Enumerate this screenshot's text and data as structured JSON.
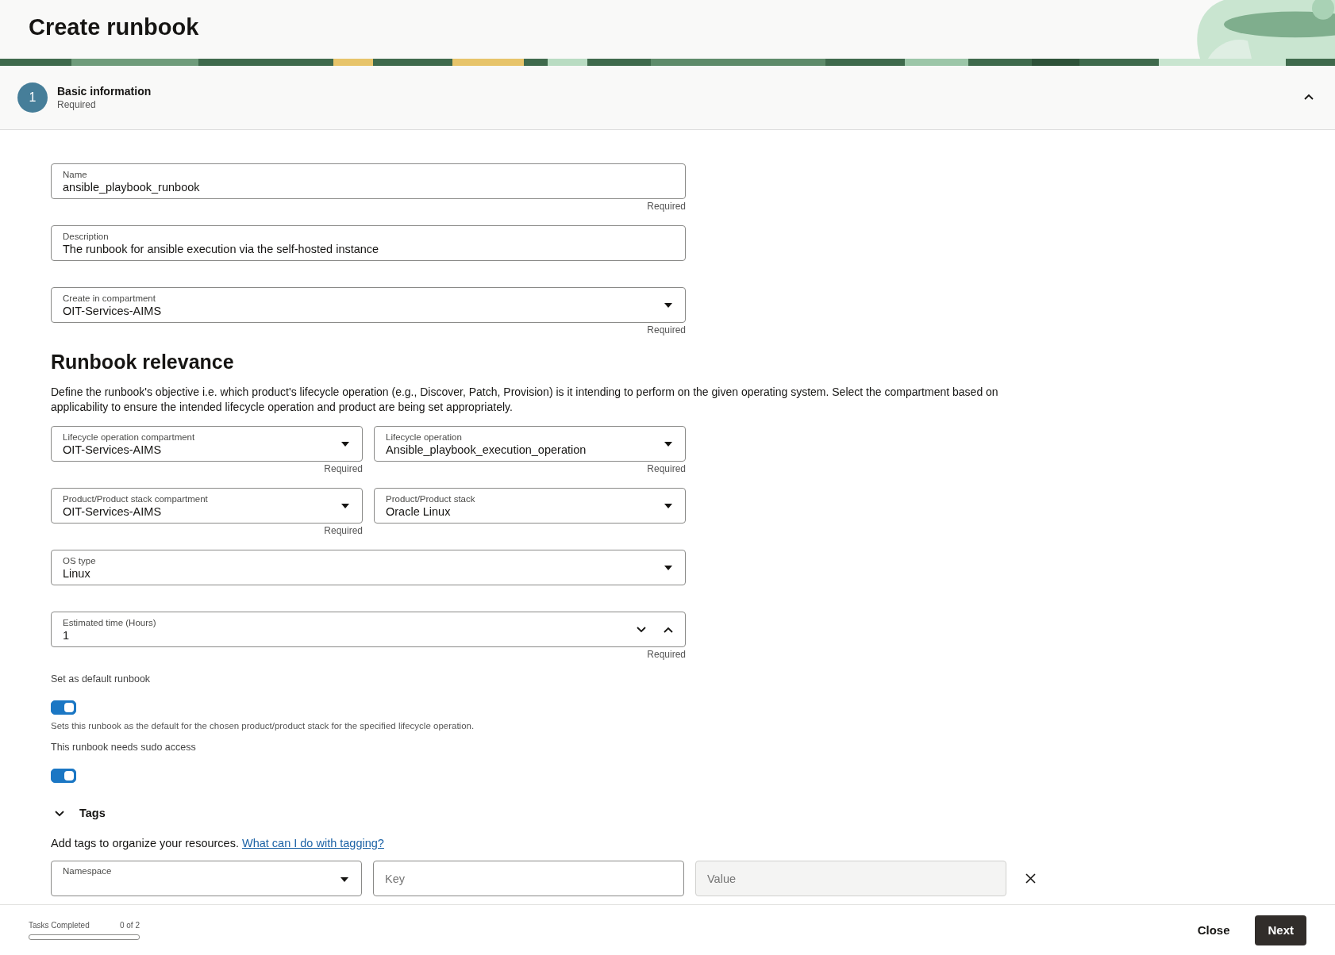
{
  "header": {
    "title": "Create runbook"
  },
  "step": {
    "number": "1",
    "title": "Basic information",
    "subtitle": "Required",
    "expanded": true
  },
  "rows": [
    {
      "fields": [
        {
          "kind": "text",
          "label": "Name",
          "value": "ansible_playbook_runbook",
          "hint": "Required"
        }
      ]
    },
    {
      "fields": [
        {
          "kind": "text",
          "label": "Description",
          "value": "The runbook for ansible execution via the self-hosted instance"
        }
      ]
    },
    {
      "fields": [
        {
          "kind": "select",
          "label": "Create in compartment",
          "value": "OIT-Services-AIMS",
          "hint": "Required"
        }
      ]
    }
  ],
  "relevance": {
    "title": "Runbook relevance",
    "description": "Define the runbook's objective i.e. which product's lifecycle operation (e.g., Discover, Patch, Provision) is it intending to perform on the given operating system. Select the compartment based on applicability to ensure the intended lifecycle operation and product are being set appropriately.",
    "rows": [
      {
        "fields": [
          {
            "kind": "select",
            "label": "Lifecycle operation compartment",
            "value": "OIT-Services-AIMS",
            "hint": "Required"
          },
          {
            "kind": "select",
            "label": "Lifecycle operation",
            "value": "Ansible_playbook_execution_operation",
            "hint": "Required"
          }
        ]
      },
      {
        "fields": [
          {
            "kind": "select",
            "label": "Product/Product stack compartment",
            "value": "OIT-Services-AIMS",
            "hint": "Required"
          },
          {
            "kind": "select",
            "label": "Product/Product stack",
            "value": "Oracle Linux"
          }
        ]
      },
      {
        "fields": [
          {
            "kind": "select",
            "label": "OS type",
            "value": "Linux"
          }
        ]
      },
      {
        "fields": [
          {
            "kind": "number",
            "label": "Estimated time (Hours)",
            "value": "1",
            "hint": "Required"
          }
        ]
      }
    ]
  },
  "toggles": [
    {
      "label": "Set as default runbook",
      "on": true,
      "help": "Sets this runbook as the default for the chosen product/product stack for the specified lifecycle operation."
    },
    {
      "label": "This runbook needs sudo access",
      "on": true
    }
  ],
  "tags": {
    "title": "Tags",
    "expanded": true,
    "intro": "Add tags to organize your resources.",
    "link": "What can I do with tagging?",
    "namespace_label": "Namespace",
    "key_placeholder": "Key",
    "value_placeholder": "Value",
    "value_disabled": true
  },
  "footer": {
    "progress_label": "Tasks Completed",
    "progress_count": "0 of 2",
    "level": 0,
    "buttons": [
      {
        "label": "Close",
        "kind": "secondary"
      },
      {
        "label": "Next",
        "kind": "primary"
      }
    ]
  }
}
